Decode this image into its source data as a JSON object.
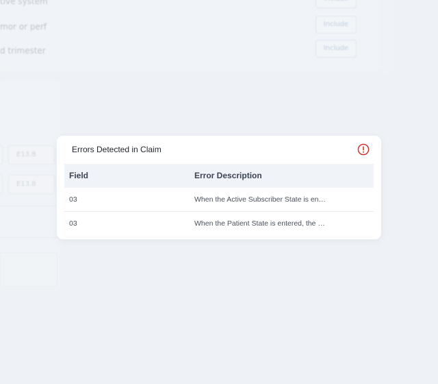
{
  "background": {
    "rows": [
      {
        "text": "tive system",
        "button": "Include"
      },
      {
        "text": "mor or perf",
        "button": "Include"
      },
      {
        "text": "d trimester",
        "button": "Include"
      }
    ],
    "codes": [
      {
        "left": "",
        "right": "E13.8"
      },
      {
        "left": "",
        "right": "E13.8"
      }
    ]
  },
  "modal": {
    "title": "Errors Detected in Claim",
    "icon": "alert-circle-icon",
    "icon_color": "#cc2b22",
    "columns": {
      "field": "Field",
      "description": "Error Description"
    },
    "rows": [
      {
        "field": "03",
        "description": "When the Active Subscriber State is entered, the Active Subscriber Zip Code must also be entered."
      },
      {
        "field": "03",
        "description": "When the Patient State is entered, the Patient Zip Code must also be entered."
      }
    ]
  }
}
